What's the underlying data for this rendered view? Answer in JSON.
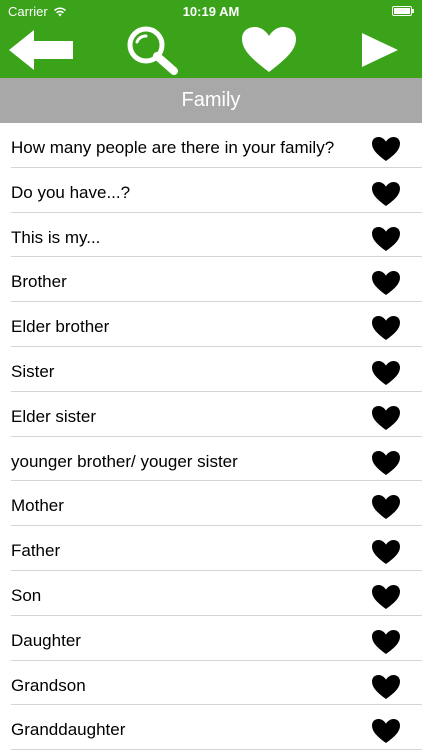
{
  "status_bar": {
    "carrier": "Carrier",
    "time": "10:19 AM"
  },
  "toolbar": {
    "back_icon": "arrow-left-icon",
    "search_icon": "search-icon",
    "favorites_icon": "heart-icon",
    "next_icon": "play-right-icon"
  },
  "section": {
    "title": "Family"
  },
  "colors": {
    "header_green": "#3aa31a",
    "section_gray": "#a8a8a8",
    "divider": "#d5d5d5"
  },
  "list": {
    "items": [
      {
        "label": "How many people are there in your family?"
      },
      {
        "label": "Do you have...?"
      },
      {
        "label": "This is my..."
      },
      {
        "label": "Brother"
      },
      {
        "label": "Elder brother"
      },
      {
        "label": "Sister"
      },
      {
        "label": "Elder sister"
      },
      {
        "label": "younger brother/ youger sister"
      },
      {
        "label": "Mother"
      },
      {
        "label": "Father"
      },
      {
        "label": "Son"
      },
      {
        "label": "Daughter"
      },
      {
        "label": "Grandson"
      },
      {
        "label": "Granddaughter"
      }
    ]
  }
}
